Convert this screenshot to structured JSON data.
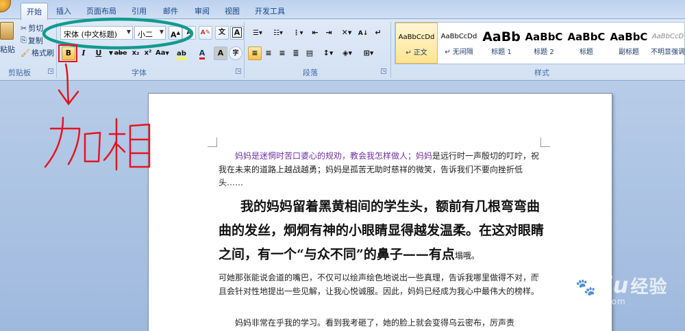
{
  "ribbon": {
    "tabs": [
      {
        "label": "开始",
        "active": true
      },
      {
        "label": "插入"
      },
      {
        "label": "页面布局"
      },
      {
        "label": "引用"
      },
      {
        "label": "邮件"
      },
      {
        "label": "审阅"
      },
      {
        "label": "视图"
      },
      {
        "label": "开发工具"
      }
    ],
    "clipboard": {
      "paste_label": "粘贴",
      "cut_label": "剪切",
      "copy_label": "复制",
      "format_painter_label": "格式刷",
      "group_label": "剪贴板"
    },
    "font": {
      "font_name": "宋体 (中文标题)",
      "font_size": "小二",
      "grow_label": "A",
      "shrink_label": "A",
      "bold_label": "B",
      "italic_label": "I",
      "underline_label": "U",
      "strike_label": "abe",
      "subscript_label": "x₂",
      "superscript_label": "x²",
      "case_label": "Aa",
      "font_color_label": "A",
      "char_shade_label": "A",
      "group_label": "字体"
    },
    "paragraph": {
      "group_label": "段落"
    },
    "styles": {
      "group_label": "样式",
      "items": [
        {
          "sample": "AaBbCcDd",
          "name": "↵ 正文"
        },
        {
          "sample": "AaBbCcDd",
          "name": "↵ 无间隔"
        },
        {
          "sample": "AaBb",
          "name": "标题 1"
        },
        {
          "sample": "AaBbC",
          "name": "标题 2"
        },
        {
          "sample": "AaBbC",
          "name": "标题"
        },
        {
          "sample": "AaBbC",
          "name": "副标题"
        },
        {
          "sample": "AaBbCcD",
          "name": "不明显强调"
        }
      ]
    }
  },
  "annotation": {
    "handwriting": "加粗",
    "ellipse_color": "#129a8e",
    "pen_color": "#e4141e"
  },
  "document": {
    "p1_purple": "妈妈是迷惘时苦口婆心的规劝，教会我怎样做人；妈妈",
    "p1_rest": "是远行时一声殷切的叮咛，祝我在未来的道路上越战越勇；妈妈是孤苦无助时慈祥的微笑，告诉我们不要向挫折低头……",
    "p2_bold": "我的妈妈留着黑黄相间的学生头，额前有几根弯弯曲曲的发丝，炯炯有神的小眼睛显得越发温柔。在这对眼睛之间，有一个“与众不同”的鼻子——有点",
    "p2_tail": "塌哦。",
    "p3": "可她那张能说会道的嘴巴，不仅可以绘声绘色地说出一些真理，告诉我哪里做得不对，而且会针对性地提出一些见解，让我心悦诚服。因此，妈妈已经成为我心中最伟大的榜样。",
    "p4": "妈妈非常在乎我的学习。看到我考砸了，她的脸上就会变得乌云密布，厉声责"
  },
  "watermark": {
    "logo": "Bai",
    "logo_mid": "du",
    "logo_zh": "经验",
    "url": "jingyan.baidu.com"
  }
}
